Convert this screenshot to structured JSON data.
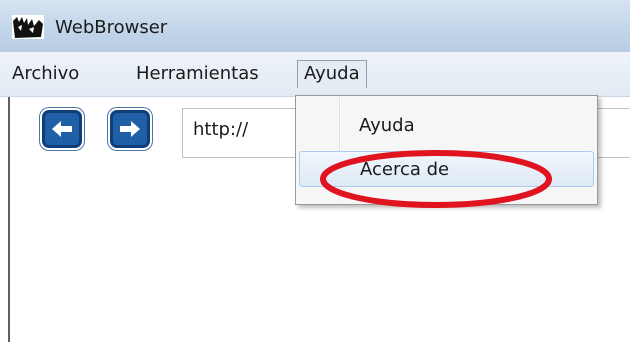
{
  "window": {
    "title": "WebBrowser",
    "icon": "app-logo-icon"
  },
  "menubar": {
    "items": [
      {
        "label": "Archivo"
      },
      {
        "label": "Herramientas"
      },
      {
        "label": "Ayuda"
      }
    ],
    "active": "Ayuda"
  },
  "toolbar": {
    "back_icon": "arrow-left-icon",
    "forward_icon": "arrow-right-icon",
    "url_value": "http://"
  },
  "dropdown": {
    "items": [
      {
        "label": "Ayuda"
      },
      {
        "label": "Acerca de"
      }
    ],
    "highlighted": "Acerca de"
  },
  "colors": {
    "titlebar": "#c3d6ea",
    "menubar": "#e2eaf3",
    "nav_button": "#1f5fa8",
    "annotation": "#e0141e",
    "hover": "#dde9f5"
  }
}
